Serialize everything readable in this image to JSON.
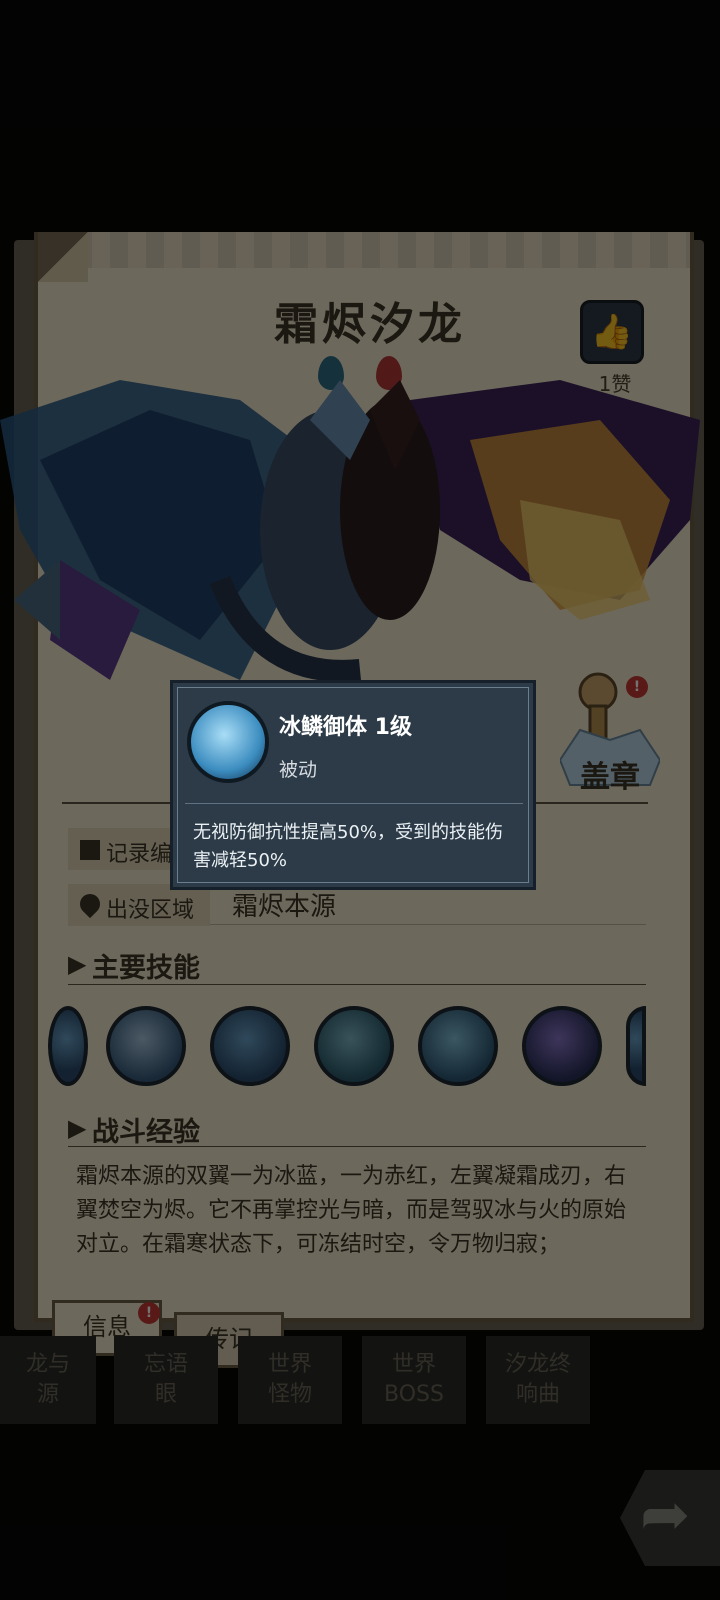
{
  "monster": {
    "name": "霜烬汐龙",
    "like_count": "1赞",
    "stamp_label": "盖章",
    "stamp_badge": "!"
  },
  "info_rows": [
    {
      "label": "记录编",
      "value": ""
    },
    {
      "label": "出没区域",
      "value": "霜烬本源"
    }
  ],
  "sections": {
    "skills_title": "主要技能",
    "combat_title": "战斗经验"
  },
  "lore": "霜烬本源的双翼一为冰蓝，一为赤红，左翼凝霜成刃，右翼焚空为烬。它不再掌控光与暗，而是驾驭冰与火的原始对立。在霜寒状态下，可冻结时空，令万物归寂；",
  "tabs": [
    {
      "label": "信息",
      "badge": "!"
    },
    {
      "label": "传记"
    }
  ],
  "bottom_tabs": [
    "龙与\n源",
    "忘语\n眼",
    "世界\n怪物",
    "世界\nBOSS",
    "汐龙终\n响曲"
  ],
  "tooltip": {
    "skill_name": "冰鳞御体 1级",
    "skill_type": "被动",
    "description": "无视防御抗性提高50%，受到的技能伤害减轻50%"
  },
  "icons": {
    "like": "thumbs-up-icon",
    "share": "share-arrow-icon",
    "left": "left-arrow-icon",
    "record": "document-icon",
    "location": "location-pin-icon"
  }
}
